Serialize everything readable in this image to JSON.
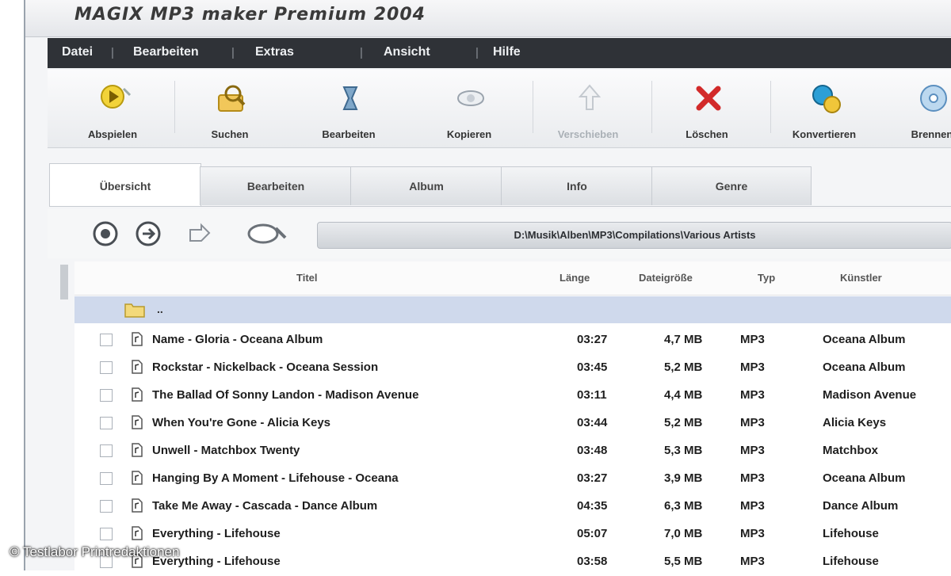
{
  "window": {
    "title": "MAGIX MP3 maker Premium 2004"
  },
  "menu": {
    "items": [
      "Datei",
      "Bearbeiten",
      "Extras",
      "Ansicht",
      "Hilfe"
    ]
  },
  "toolbar": {
    "buttons": [
      {
        "label": "Abspielen",
        "icon": "play-icon",
        "enabled": true
      },
      {
        "label": "Suchen",
        "icon": "search-icon",
        "enabled": true
      },
      {
        "label": "Bearbeiten",
        "icon": "edit-icon",
        "enabled": true
      },
      {
        "label": "Kopieren",
        "icon": "copy-icon",
        "enabled": true
      },
      {
        "label": "Verschieben",
        "icon": "move-icon",
        "enabled": false
      },
      {
        "label": "Löschen",
        "icon": "delete-icon",
        "enabled": true
      },
      {
        "label": "Konvertieren",
        "icon": "convert-icon",
        "enabled": true
      },
      {
        "label": "Brennen",
        "icon": "burn-icon",
        "enabled": true
      }
    ]
  },
  "tabs": [
    {
      "label": "Übersicht",
      "active": true
    },
    {
      "label": "Bearbeiten",
      "active": false
    },
    {
      "label": "Album",
      "active": false
    },
    {
      "label": "Info",
      "active": false
    },
    {
      "label": "Genre",
      "active": false
    }
  ],
  "nav": {
    "path": "D:\\Musik\\Alben\\MP3\\Compilations\\Various Artists"
  },
  "list": {
    "columns": {
      "title": "Titel",
      "duration": "Länge",
      "size": "Dateigröße",
      "type": "Typ",
      "artist": "Künstler"
    },
    "folder": "..",
    "rows": [
      {
        "title": "Name - Gloria - Oceana Album",
        "duration": "03:27",
        "size": "4,7 MB",
        "type": "MP3",
        "artist": "Oceana Album"
      },
      {
        "title": "Rockstar - Nickelback - Oceana Session",
        "duration": "03:45",
        "size": "5,2 MB",
        "type": "MP3",
        "artist": "Oceana Album"
      },
      {
        "title": "The Ballad Of Sonny Landon - Madison Avenue",
        "duration": "03:11",
        "size": "4,4 MB",
        "type": "MP3",
        "artist": "Madison Avenue"
      },
      {
        "title": "When You're Gone - Alicia Keys",
        "duration": "03:44",
        "size": "5,2 MB",
        "type": "MP3",
        "artist": "Alicia Keys"
      },
      {
        "title": "Unwell - Matchbox Twenty",
        "duration": "03:48",
        "size": "5,3 MB",
        "type": "MP3",
        "artist": "Matchbox"
      },
      {
        "title": "Hanging By A Moment - Lifehouse - Oceana",
        "duration": "03:27",
        "size": "3,9 MB",
        "type": "MP3",
        "artist": "Oceana Album"
      },
      {
        "title": "Take Me Away - Cascada - Dance Album",
        "duration": "04:35",
        "size": "6,3 MB",
        "type": "MP3",
        "artist": "Dance Album"
      },
      {
        "title": "Everything - Lifehouse",
        "duration": "05:07",
        "size": "7,0 MB",
        "type": "MP3",
        "artist": "Lifehouse"
      },
      {
        "title": "Everything - Lifehouse",
        "duration": "03:58",
        "size": "5,5 MB",
        "type": "MP3",
        "artist": "Lifehouse"
      }
    ]
  },
  "credit": "© Testlabor Printredaktionen"
}
